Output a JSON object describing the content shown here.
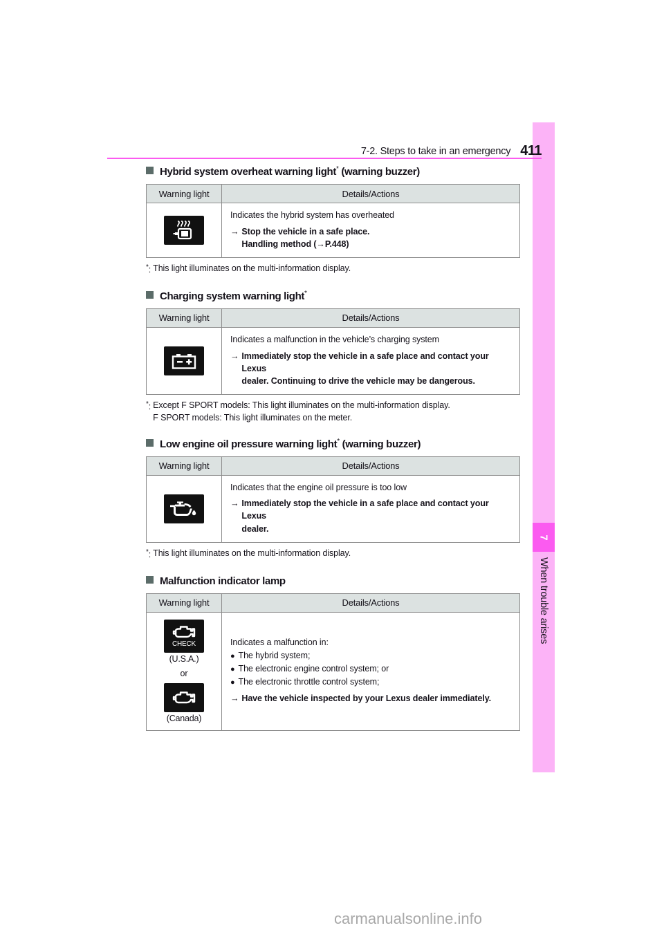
{
  "header": {
    "title": "7-2. Steps to take in an emergency",
    "page_number": "411",
    "rule_color": "#fb5bf0"
  },
  "side_tab": {
    "chapter_number": "7",
    "chapter_label": "When trouble arises",
    "bar_color": "#fcb3f7",
    "box_color": "#fb5bf0"
  },
  "table_headers": {
    "warning_light": "Warning light",
    "details_actions": "Details/Actions"
  },
  "sections": [
    {
      "id": "hybrid-system-overheat",
      "title": "Hybrid system overheat warning light",
      "title_sup": "*",
      "title_suffix": " (warning buzzer)",
      "icon_name": "hybrid-overheat-warning-icon",
      "details_line": "Indicates the hybrid system has overheated",
      "action_arrow": "→",
      "action_line1": "Stop the vehicle in a safe place.",
      "action_line2": "Handling method (→P.448)",
      "footnote_mark": "*",
      "footnote_lines": [
        "This light illuminates on the multi-information display."
      ]
    },
    {
      "id": "charging-system",
      "title": "Charging system warning light",
      "title_sup": "*",
      "title_suffix": "",
      "icon_name": "battery-charging-warning-icon",
      "details_line": "Indicates a malfunction in the vehicle’s charging system",
      "action_arrow": "→",
      "action_line1": "Immediately stop the vehicle in a safe place and contact your Lexus",
      "action_line2": "dealer. Continuing to drive the vehicle may be dangerous.",
      "footnote_mark": "*",
      "footnote_lines": [
        "Except F SPORT models: This light illuminates on the multi-information display.",
        "F SPORT models: This light illuminates on the meter."
      ]
    },
    {
      "id": "low-engine-oil-pressure",
      "title": "Low engine oil pressure warning light",
      "title_sup": "*",
      "title_suffix": " (warning buzzer)",
      "icon_name": "oil-pressure-warning-icon",
      "details_line": "Indicates that the engine oil pressure is too low",
      "action_arrow": "→",
      "action_line1": "Immediately stop the vehicle in a safe place and contact your Lexus",
      "action_line2": "dealer.",
      "footnote_mark": "*",
      "footnote_lines": [
        "This light illuminates on the multi-information display."
      ]
    }
  ],
  "malfunction_section": {
    "id": "malfunction-indicator-lamp",
    "title": "Malfunction indicator lamp",
    "icons": [
      {
        "icon_name": "check-engine-usa-icon",
        "badge_text": "CHECK",
        "caption": "(U.S.A.)"
      },
      {
        "icon_name": "check-engine-canada-icon",
        "badge_text": "",
        "caption": "(Canada)"
      }
    ],
    "separator": "or",
    "details_line": "Indicates a malfunction in:",
    "bullet_char": "●",
    "bullets": [
      "The hybrid system;",
      "The electronic engine control system; or",
      "The electronic throttle control system;"
    ],
    "action_arrow": "→",
    "action_line1": "Have the vehicle inspected by your Lexus dealer immediately."
  },
  "watermark": {
    "text": "carmanualsonline.info"
  }
}
